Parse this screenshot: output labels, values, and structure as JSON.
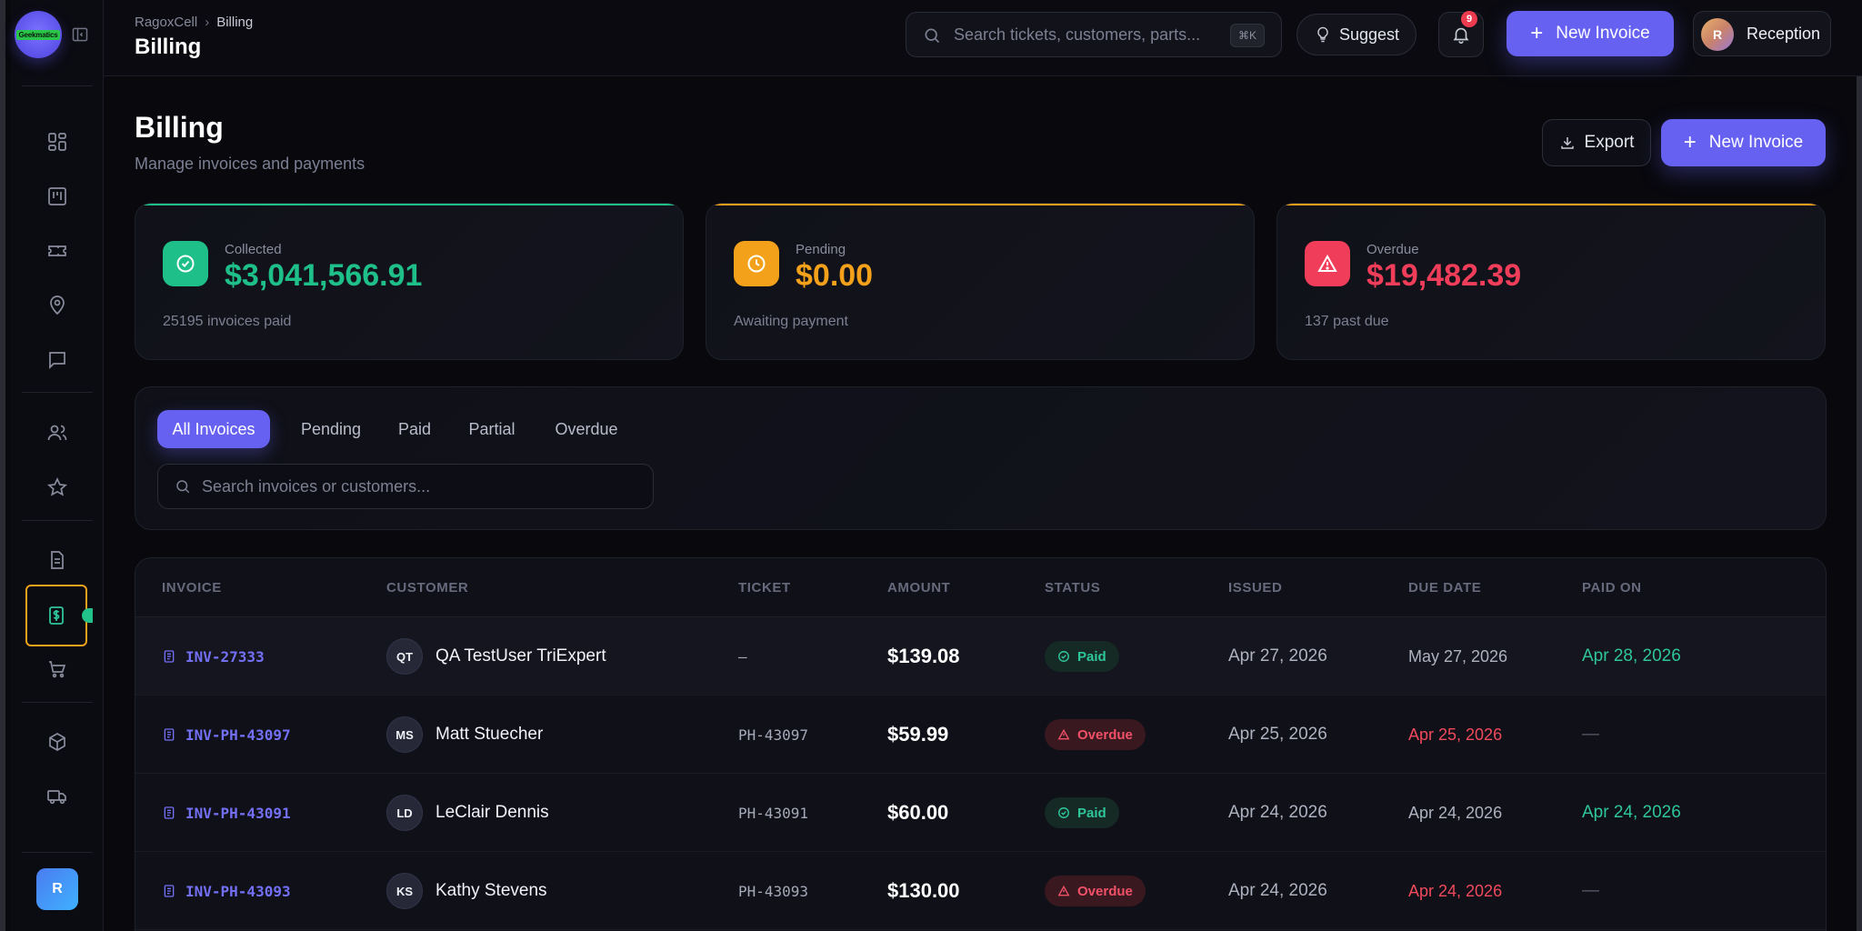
{
  "sidebar": {
    "logo_text": "Geekmatics",
    "user_initial": "R"
  },
  "topbar": {
    "breadcrumb_root": "RagoxCell",
    "breadcrumb_current": "Billing",
    "title": "Billing",
    "search_placeholder": "Search tickets, customers, parts...",
    "search_shortcut": "⌘K",
    "suggest_label": "Suggest",
    "notification_count": "9",
    "new_invoice_label": "New Invoice",
    "user_initial": "R",
    "user_name": "Reception"
  },
  "page": {
    "title": "Billing",
    "subtitle": "Manage invoices and payments",
    "export_label": "Export",
    "new_invoice_label": "New Invoice"
  },
  "stats": [
    {
      "label": "Collected",
      "value": "$3,041,566.91",
      "foot": "25195 invoices paid",
      "color": "#1fbf8a"
    },
    {
      "label": "Pending",
      "value": "$0.00",
      "foot": "Awaiting payment",
      "color": "#f3a11a"
    },
    {
      "label": "Overdue",
      "value": "$19,482.39",
      "foot": "137 past due",
      "color": "#f03e5a"
    }
  ],
  "filters": {
    "tabs": [
      "All Invoices",
      "Pending",
      "Paid",
      "Partial",
      "Overdue"
    ],
    "active_tab": "All Invoices",
    "search_placeholder": "Search invoices or customers..."
  },
  "table": {
    "columns": [
      "INVOICE",
      "CUSTOMER",
      "TICKET",
      "AMOUNT",
      "STATUS",
      "ISSUED",
      "DUE DATE",
      "PAID ON"
    ],
    "rows": [
      {
        "invoice": "INV-27333",
        "initials": "QT",
        "customer": "QA TestUser TriExpert",
        "ticket": "–",
        "amount": "$139.08",
        "status": "Paid",
        "issued": "Apr 27, 2026",
        "due": "May 27, 2026",
        "paid_on": "Apr 28, 2026"
      },
      {
        "invoice": "INV-PH-43097",
        "initials": "MS",
        "customer": "Matt Stuecher",
        "ticket": "PH-43097",
        "amount": "$59.99",
        "status": "Overdue",
        "issued": "Apr 25, 2026",
        "due": "Apr 25, 2026",
        "paid_on": "—"
      },
      {
        "invoice": "INV-PH-43091",
        "initials": "LD",
        "customer": "LeClair Dennis",
        "ticket": "PH-43091",
        "amount": "$60.00",
        "status": "Paid",
        "issued": "Apr 24, 2026",
        "due": "Apr 24, 2026",
        "paid_on": "Apr 24, 2026"
      },
      {
        "invoice": "INV-PH-43093",
        "initials": "KS",
        "customer": "Kathy Stevens",
        "ticket": "PH-43093",
        "amount": "$130.00",
        "status": "Overdue",
        "issued": "Apr 24, 2026",
        "due": "Apr 24, 2026",
        "paid_on": "—"
      }
    ]
  },
  "colors": {
    "accent": "#6661f0",
    "paid": "#2fc69a",
    "overdue": "#f05166",
    "active_nav_outline": "#f0a21c"
  }
}
